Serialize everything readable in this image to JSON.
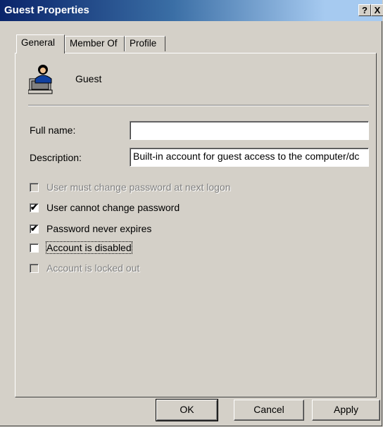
{
  "window": {
    "title": "Guest Properties",
    "help_glyph": "?",
    "close_glyph": "X"
  },
  "tabs": [
    {
      "label": "General",
      "active": true
    },
    {
      "label": "Member Of",
      "active": false
    },
    {
      "label": "Profile",
      "active": false
    }
  ],
  "user": {
    "name": "Guest",
    "icon": "user-computer-icon"
  },
  "fields": {
    "full_name": {
      "label": "Full name:",
      "value": ""
    },
    "description": {
      "label": "Description:",
      "value": "Built-in account for guest access to the computer/dc"
    }
  },
  "checkboxes": [
    {
      "label": "User must change password at next logon",
      "checked": false,
      "enabled": false
    },
    {
      "label": "User cannot change password",
      "checked": true,
      "enabled": true
    },
    {
      "label": "Password never expires",
      "checked": true,
      "enabled": true
    },
    {
      "label": "Account is disabled",
      "checked": false,
      "enabled": true,
      "focused": true
    },
    {
      "label": "Account is locked out",
      "checked": false,
      "enabled": false
    }
  ],
  "buttons": {
    "ok": "OK",
    "cancel": "Cancel",
    "apply": "Apply"
  },
  "colors": {
    "face": "#d4d0c8",
    "title_start": "#0a246a",
    "title_end": "#a6caf0"
  }
}
